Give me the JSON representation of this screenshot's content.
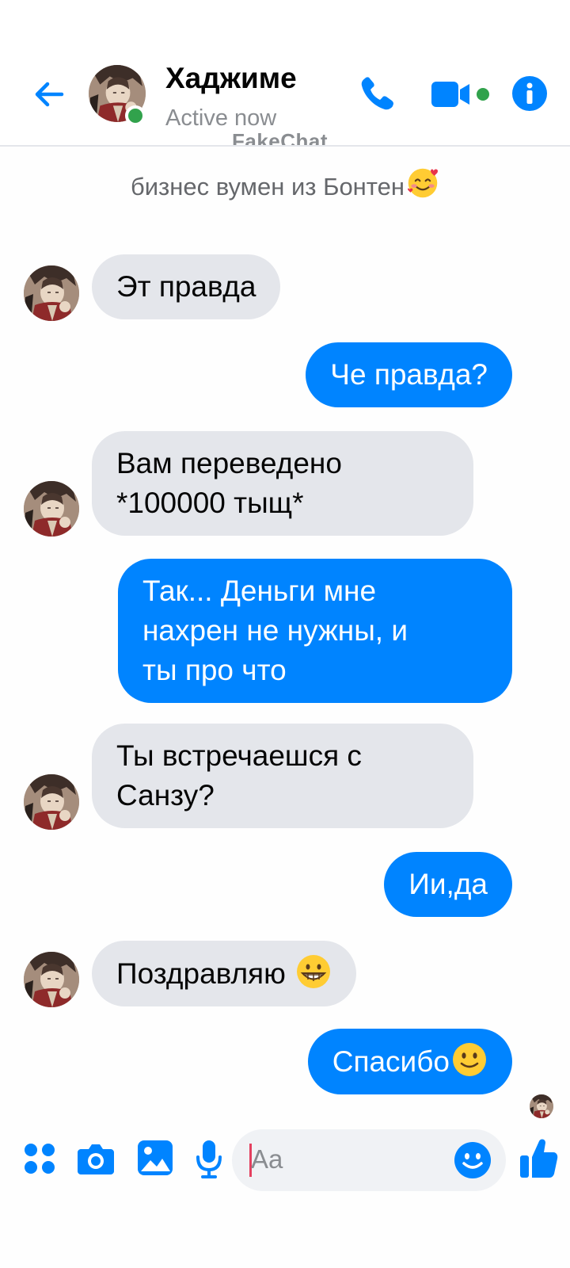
{
  "header": {
    "name": "Хаджиме",
    "status": "Active now",
    "watermark": "FakeChat"
  },
  "bio": "бизнес вумен из Бонтен",
  "messages": [
    {
      "direction": "in",
      "text": "Эт правда"
    },
    {
      "direction": "out",
      "text": "Че правда?"
    },
    {
      "direction": "in",
      "line1": "Вам переведено",
      "line2": "*100000 тыщ*"
    },
    {
      "direction": "out",
      "line1": "Так... Деньги мне",
      "line2": "нахрен не нужны, и",
      "line3": "ты про что"
    },
    {
      "direction": "in",
      "line1": "Ты встречаешся с",
      "line2": "Санзу?"
    },
    {
      "direction": "out",
      "text": "Ии,да"
    },
    {
      "direction": "in",
      "text": "Поздравляю",
      "emoji": "grinning-face-emoji"
    },
    {
      "direction": "out",
      "text": "Спасибо",
      "emoji": "slightly-smiling-face-emoji"
    }
  ],
  "composer": {
    "placeholder": "Aa"
  },
  "icons": {
    "back": "back-arrow-icon",
    "call": "phone-icon",
    "video": "video-camera-icon",
    "info": "info-icon",
    "apps": "apps-icon",
    "camera": "camera-icon",
    "gallery": "gallery-icon",
    "mic": "microphone-icon",
    "emoji": "smile-icon",
    "like": "thumbs-up-icon"
  },
  "colors": {
    "accent": "#0084ff",
    "incoming_bubble": "#e4e6eb",
    "online": "#31a24c"
  }
}
